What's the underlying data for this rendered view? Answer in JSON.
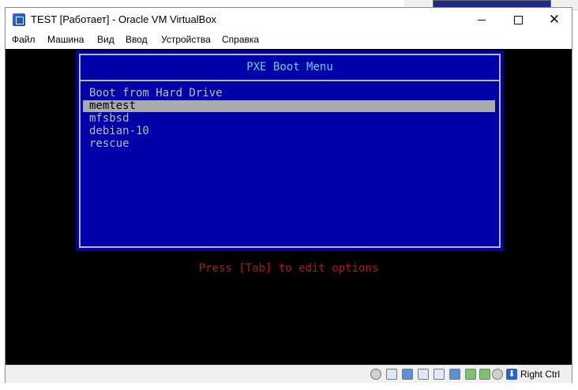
{
  "window": {
    "title": "TEST [Работает] - Oracle VM VirtualBox"
  },
  "menu": {
    "items": [
      "Файл",
      "Машина",
      "Вид",
      "Ввод",
      "Устройства",
      "Справка"
    ]
  },
  "pxe": {
    "title": "PXE Boot Menu",
    "entries": [
      {
        "label": "Boot from Hard Drive",
        "selected": false
      },
      {
        "label": "memtest",
        "selected": true
      },
      {
        "label": "mfsbsd",
        "selected": false
      },
      {
        "label": "debian-10",
        "selected": false
      },
      {
        "label": "rescue",
        "selected": false
      }
    ],
    "hint": "Press [Tab] to edit options"
  },
  "statusbar": {
    "icons": [
      "optical-drive-icon",
      "audio-icon",
      "network-icon",
      "usb-icon",
      "shared-folders-icon",
      "display-icon",
      "video-capture-icon",
      "cpu-icon",
      "mouse-integration-icon"
    ],
    "host_key_label": "Right Ctrl"
  },
  "colors": {
    "pxe_background": "#0000a8",
    "pxe_title": "#5cd6f0",
    "pxe_text": "#bcbcbc",
    "pxe_selected_bg": "#aaaaaa",
    "hint_text": "#a81c1c"
  }
}
